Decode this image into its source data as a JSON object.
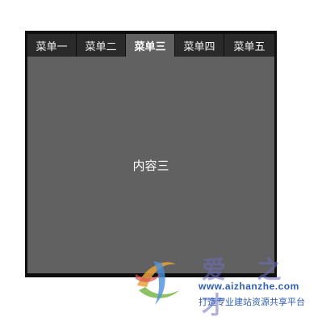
{
  "tabs": [
    {
      "label": "菜单一",
      "active": false
    },
    {
      "label": "菜单二",
      "active": false
    },
    {
      "label": "菜单三",
      "active": true
    },
    {
      "label": "菜单四",
      "active": false
    },
    {
      "label": "菜单五",
      "active": false
    }
  ],
  "content": {
    "text": "内容三"
  },
  "watermark": {
    "brand": "爱 之 才",
    "url": "www.aizhanzhe.com",
    "slogan": "打造专业建站资源共享平台",
    "logo_icon": "swirl-logo-icon"
  },
  "colors": {
    "frame": "#0e0e0e",
    "tab_inactive": "#2a2a2a",
    "tab_active": "#616161",
    "content_bg": "#616161",
    "watermark_text": "#2f5fb5"
  }
}
